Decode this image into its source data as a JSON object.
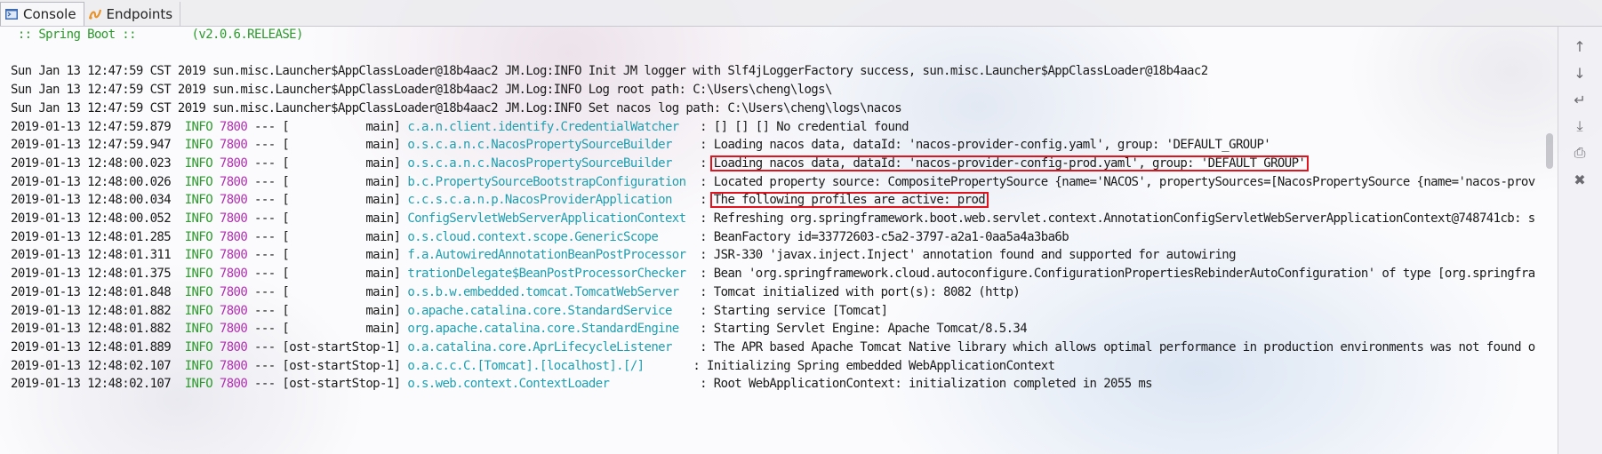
{
  "tabs": [
    {
      "label": "Console",
      "icon": "console-icon",
      "active": true
    },
    {
      "label": "Endpoints",
      "icon": "endpoints-icon",
      "active": false
    }
  ],
  "banner": " :: Spring Boot ::        (v2.0.6.RELEASE)",
  "plain_lines": [
    "Sun Jan 13 12:47:59 CST 2019 sun.misc.Launcher$AppClassLoader@18b4aac2 JM.Log:INFO Init JM logger with Slf4jLoggerFactory success, sun.misc.Launcher$AppClassLoader@18b4aac2",
    "Sun Jan 13 12:47:59 CST 2019 sun.misc.Launcher$AppClassLoader@18b4aac2 JM.Log:INFO Log root path: C:\\Users\\cheng\\logs\\",
    "Sun Jan 13 12:47:59 CST 2019 sun.misc.Launcher$AppClassLoader@18b4aac2 JM.Log:INFO Set nacos log path: C:\\Users\\cheng\\logs\\nacos"
  ],
  "log_lines": [
    {
      "ts": "2019-01-13 12:47:59.879",
      "level": "INFO",
      "pid": "7800",
      "sep": " --- [",
      "thread": "           main]",
      "logger": "c.a.n.client.identify.CredentialWatcher  ",
      "msg": ": [] [] [] No credential found"
    },
    {
      "ts": "2019-01-13 12:47:59.947",
      "level": "INFO",
      "pid": "7800",
      "sep": " --- [",
      "thread": "           main]",
      "logger": "o.s.c.a.n.c.NacosPropertySourceBuilder   ",
      "msg": ": Loading nacos data, dataId: 'nacos-provider-config.yaml', group: 'DEFAULT_GROUP'"
    },
    {
      "ts": "2019-01-13 12:48:00.023",
      "level": "INFO",
      "pid": "7800",
      "sep": " --- [",
      "thread": "           main]",
      "logger": "o.s.c.a.n.c.NacosPropertySourceBuilder   ",
      "msg": ": Loading nacos data, dataId: 'nacos-provider-config-prod.yaml', group: 'DEFAULT_GROUP'"
    },
    {
      "ts": "2019-01-13 12:48:00.026",
      "level": "INFO",
      "pid": "7800",
      "sep": " --- [",
      "thread": "           main]",
      "logger": "b.c.PropertySourceBootstrapConfiguration ",
      "msg": ": Located property source: CompositePropertySource {name='NACOS', propertySources=[NacosPropertySource {name='nacos-prov"
    },
    {
      "ts": "2019-01-13 12:48:00.034",
      "level": "INFO",
      "pid": "7800",
      "sep": " --- [",
      "thread": "           main]",
      "logger": "c.c.s.c.a.n.p.NacosProviderApplication   ",
      "msg": ": The following profiles are active: prod"
    },
    {
      "ts": "2019-01-13 12:48:00.052",
      "level": "INFO",
      "pid": "7800",
      "sep": " --- [",
      "thread": "           main]",
      "logger": "ConfigServletWebServerApplicationContext ",
      "msg": ": Refreshing org.springframework.boot.web.servlet.context.AnnotationConfigServletWebServerApplicationContext@748741cb: s"
    },
    {
      "ts": "2019-01-13 12:48:01.285",
      "level": "INFO",
      "pid": "7800",
      "sep": " --- [",
      "thread": "           main]",
      "logger": "o.s.cloud.context.scope.GenericScope     ",
      "msg": ": BeanFactory id=33772603-c5a2-3797-a2a1-0aa5a4a3ba6b"
    },
    {
      "ts": "2019-01-13 12:48:01.311",
      "level": "INFO",
      "pid": "7800",
      "sep": " --- [",
      "thread": "           main]",
      "logger": "f.a.AutowiredAnnotationBeanPostProcessor ",
      "msg": ": JSR-330 'javax.inject.Inject' annotation found and supported for autowiring"
    },
    {
      "ts": "2019-01-13 12:48:01.375",
      "level": "INFO",
      "pid": "7800",
      "sep": " --- [",
      "thread": "           main]",
      "logger": "trationDelegate$BeanPostProcessorChecker ",
      "msg": ": Bean 'org.springframework.cloud.autoconfigure.ConfigurationPropertiesRebinderAutoConfiguration' of type [org.springfra"
    },
    {
      "ts": "2019-01-13 12:48:01.848",
      "level": "INFO",
      "pid": "7800",
      "sep": " --- [",
      "thread": "           main]",
      "logger": "o.s.b.w.embedded.tomcat.TomcatWebServer  ",
      "msg": ": Tomcat initialized with port(s): 8082 (http)"
    },
    {
      "ts": "2019-01-13 12:48:01.882",
      "level": "INFO",
      "pid": "7800",
      "sep": " --- [",
      "thread": "           main]",
      "logger": "o.apache.catalina.core.StandardService   ",
      "msg": ": Starting service [Tomcat]"
    },
    {
      "ts": "2019-01-13 12:48:01.882",
      "level": "INFO",
      "pid": "7800",
      "sep": " --- [",
      "thread": "           main]",
      "logger": "org.apache.catalina.core.StandardEngine  ",
      "msg": ": Starting Servlet Engine: Apache Tomcat/8.5.34"
    },
    {
      "ts": "2019-01-13 12:48:01.889",
      "level": "INFO",
      "pid": "7800",
      "sep": " --- [",
      "thread": "ost-startStop-1]",
      "logger": "o.a.catalina.core.AprLifecycleListener   ",
      "msg": ": The APR based Apache Tomcat Native library which allows optimal performance in production environments was not found o"
    },
    {
      "ts": "2019-01-13 12:48:02.107",
      "level": "INFO",
      "pid": "7800",
      "sep": " --- [",
      "thread": "ost-startStop-1]",
      "logger": "o.a.c.c.C.[Tomcat].[localhost].[/]      ",
      "msg": ": Initializing Spring embedded WebApplicationContext"
    },
    {
      "ts": "2019-01-13 12:48:02.107",
      "level": "INFO",
      "pid": "7800",
      "sep": " --- [",
      "thread": "ost-startStop-1]",
      "logger": "o.s.web.context.ContextLoader            ",
      "msg": ": Root WebApplicationContext: initialization completed in 2055 ms"
    }
  ],
  "highlighted_rows": [
    2,
    4
  ],
  "toolbar_icons": [
    "scroll-up-icon",
    "scroll-down-icon",
    "soft-wrap-icon",
    "scroll-to-end-icon",
    "print-icon",
    "trash-icon"
  ],
  "colors": {
    "level": "#2a9b2a",
    "pid": "#b030b0",
    "logger": "#1e9fb0",
    "highlight": "#e0141e"
  }
}
